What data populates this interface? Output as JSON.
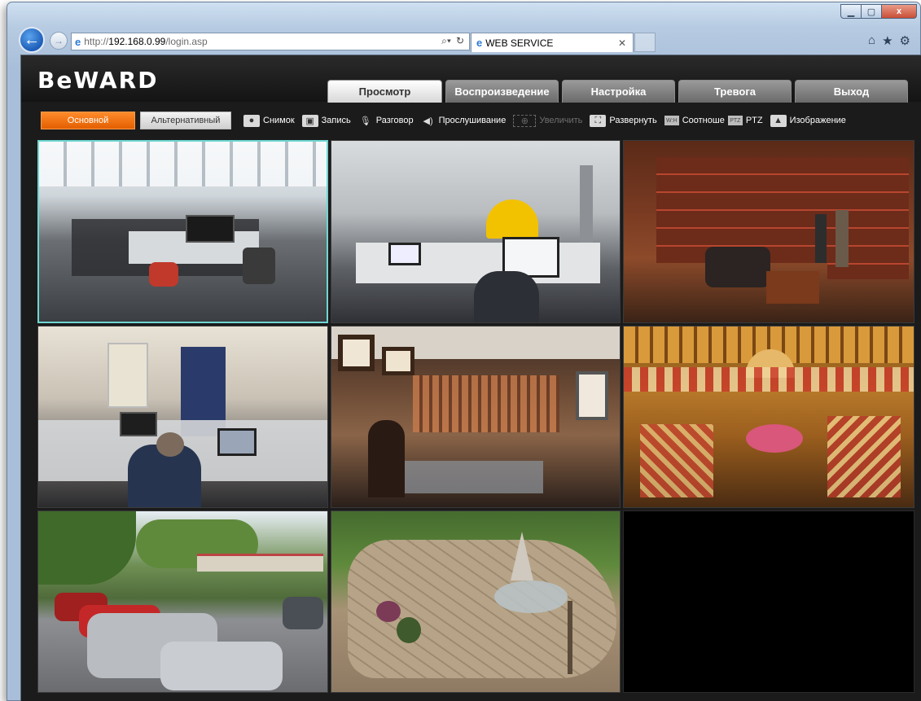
{
  "browser": {
    "url_prefix": "http://",
    "url_host": "192.168.0.99",
    "url_path": "/login.asp",
    "tab_title": "WEB SERVICE",
    "window_controls": {
      "minimize": "▁",
      "maximize": "▢",
      "close": "x"
    }
  },
  "app": {
    "logo": "BeWARD",
    "main_tabs": [
      {
        "label": "Просмотр",
        "active": true
      },
      {
        "label": "Воспроизведение",
        "active": false
      },
      {
        "label": "Настройка",
        "active": false
      },
      {
        "label": "Тревога",
        "active": false
      },
      {
        "label": "Выход",
        "active": false
      }
    ],
    "toolbar": {
      "primary_stream": "Основной",
      "secondary_stream": "Альтернативный",
      "snapshot": "Снимок",
      "record": "Запись",
      "talk": "Разговор",
      "listen": "Прослушивание",
      "zoom": "Увеличить",
      "expand": "Развернуть",
      "aspect": "Соотноше",
      "ptz": "PTZ",
      "ptz_icon": "PTZ",
      "aspect_icon": "W:H",
      "image": "Изображение"
    },
    "cameras": [
      {
        "scene": "open-plan office",
        "selected": true
      },
      {
        "scene": "office workstations"
      },
      {
        "scene": "book store"
      },
      {
        "scene": "office room"
      },
      {
        "scene": "gift shop"
      },
      {
        "scene": "shopping hall"
      },
      {
        "scene": "parking yard"
      },
      {
        "scene": "garden patio"
      },
      {
        "scene": "empty"
      }
    ]
  }
}
